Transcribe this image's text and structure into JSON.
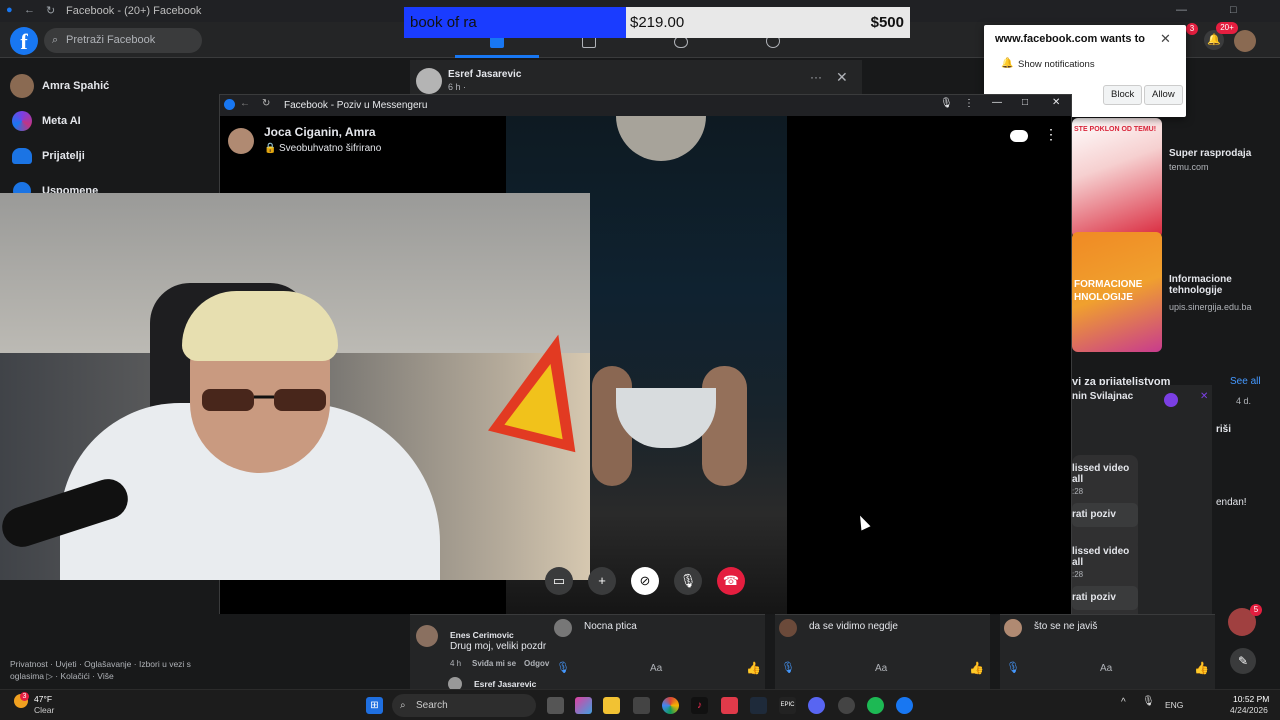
{
  "browser": {
    "title": "Facebook - (20+) Facebook"
  },
  "fb_header": {
    "logo": "f",
    "search_placeholder": "Pretraži Facebook",
    "notif_badge_msgr": "3",
    "notif_badge_bell": "20+"
  },
  "sidebar": {
    "items": [
      {
        "label": "Amra Spahić"
      },
      {
        "label": "Meta AI"
      },
      {
        "label": "Prijatelji"
      },
      {
        "label": "Uspomene"
      }
    ],
    "footer": "Privatnost · Uvjeti · Oglašavanje · Izbori u vezi s oglasima ▷ · Kolačići · Više"
  },
  "banner": {
    "left": "book of ra",
    "mid": "$219.00",
    "right": "$500"
  },
  "post": {
    "author": "Esref Jasarevic",
    "time": "6 h ·"
  },
  "notification": {
    "title": "www.facebook.com wants to",
    "row": "Show notifications",
    "block": "Block",
    "allow": "Allow"
  },
  "right_col": {
    "ads": [
      {
        "title": "Super rasprodaja",
        "url": "temu.com",
        "img_text": "STE POKLON OD TEMU!"
      },
      {
        "title": "Informacione tehnologije",
        "url": "upis.sinergija.edu.ba",
        "img_text": "FORMACIONE HNOLOGIJE"
      }
    ],
    "friends_heading": "vi za prijateljstvom",
    "see_all": "See all",
    "friend_name": "nin Svilajnac",
    "friend_time": "4 d.",
    "missed_1": "lissed video all",
    "missed_1_time": ":28",
    "recall_1": "rati poziv",
    "missed_2": "lissed video all",
    "missed_2_time": ":28",
    "recall_2": "rati poziv",
    "side_snip": "endan!",
    "side_snip2": "riši"
  },
  "messenger": {
    "window_title": "Facebook - Poziv u Messengeru",
    "call_name": "Joca Ciganin, Amra",
    "encrypted": "Sveobuhvatno šifrirano"
  },
  "chats": [
    {
      "author": "Enes Cerimovic",
      "text": "Drug moj, veliki pozdr",
      "time": "4 h",
      "like": "Sviđa mi se",
      "reply": "Odgov",
      "next_author": "Esref Jasarevic"
    },
    {
      "text": "Nocna ptica",
      "placeholder": "Aa"
    },
    {
      "text": "da se vidimo negdje",
      "placeholder": "Aa"
    },
    {
      "text": "što se ne javiš",
      "placeholder": "Aa"
    }
  ],
  "float_badge": "5",
  "taskbar": {
    "weather_temp": "47°F",
    "weather_cond": "Clear",
    "weather_badge": "3",
    "search": "Search",
    "lang": "ENG",
    "time": "10:52 PM",
    "date": "4/24/2026"
  },
  "colors": {
    "fb_blue": "#1877f2",
    "end_call": "#e41e3f",
    "banner_blue": "#1a3cff"
  }
}
